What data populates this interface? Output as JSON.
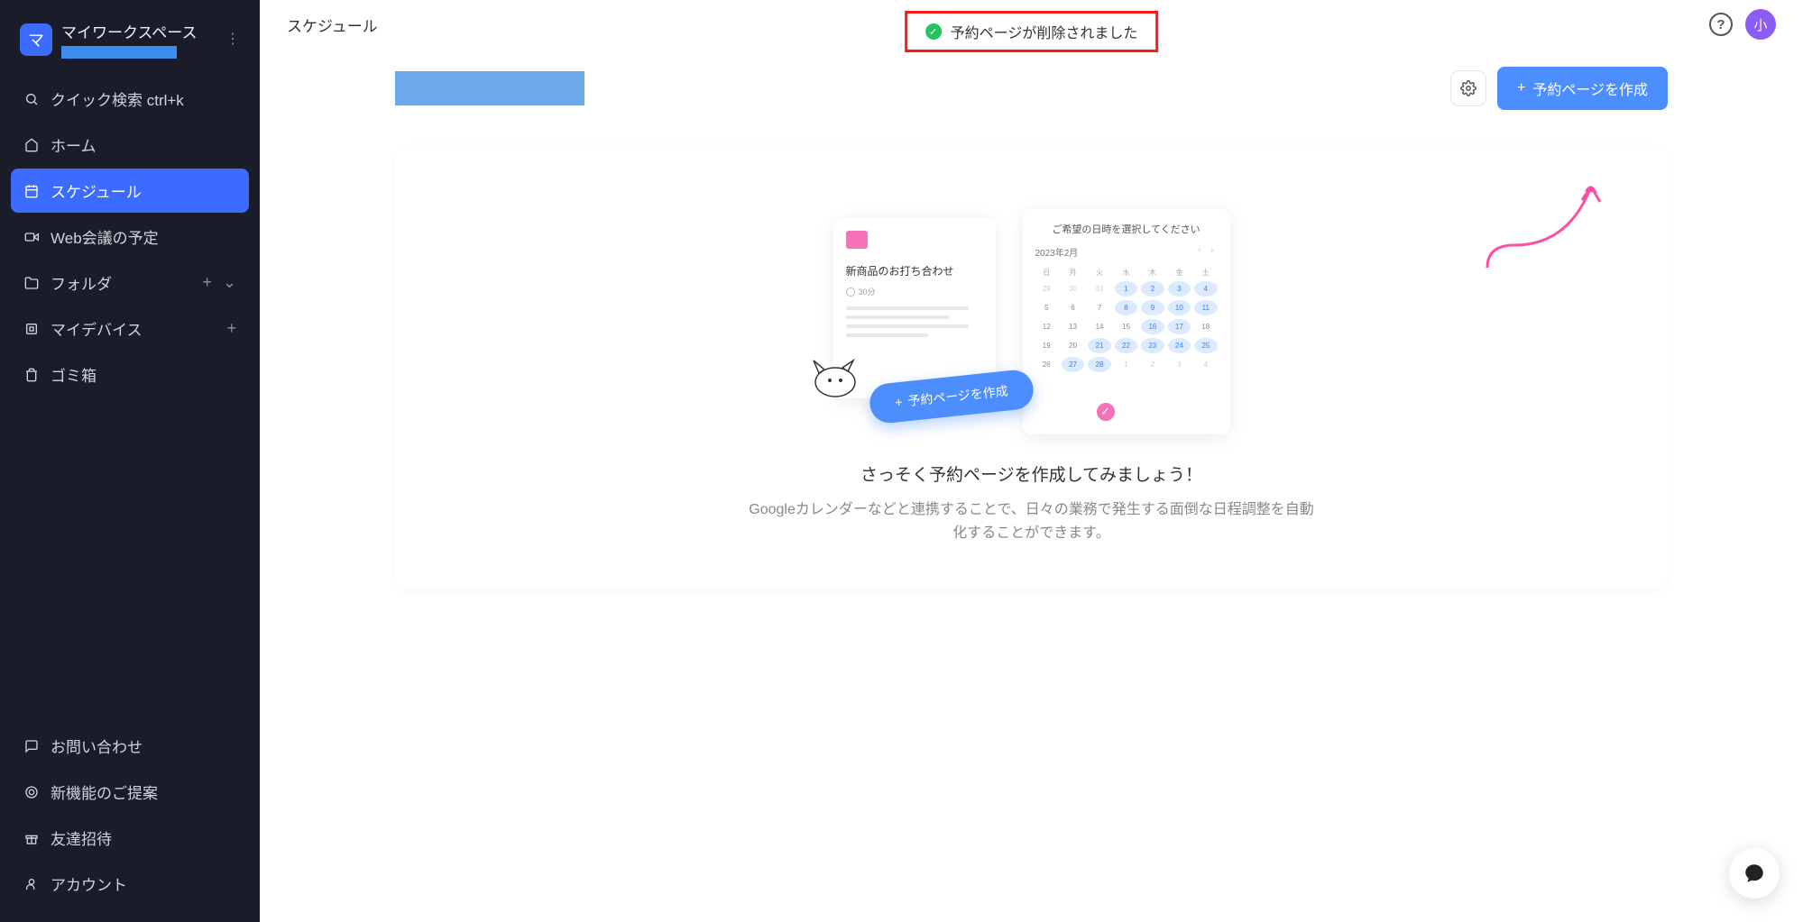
{
  "workspace": {
    "badge": "マ",
    "title": "マイワークスペース"
  },
  "sidebar": {
    "search": "クイック検索 ctrl+k",
    "home": "ホーム",
    "schedule": "スケジュール",
    "web_meeting": "Web会議の予定",
    "folder": "フォルダ",
    "my_device": "マイデバイス",
    "trash": "ゴミ箱",
    "contact": "お問い合わせ",
    "feedback": "新機能のご提案",
    "invite": "友達招待",
    "account": "アカウント"
  },
  "topbar": {
    "title": "スケジュール",
    "avatar": "小"
  },
  "toast": {
    "message": "予約ページが削除されました"
  },
  "actions": {
    "create_button": "予約ページを作成"
  },
  "empty": {
    "title": "さっそく予約ページを作成してみましょう！",
    "desc": "Googleカレンダーなどと連携することで、日々の業務で発生する面倒な日程調整を自動化することができます。"
  },
  "illus": {
    "panel_title": "新商品のお打ち合わせ",
    "panel_sub": "30分",
    "cal_title": "ご希望の日時を選択してください",
    "cal_month": "2023年2月",
    "dow": [
      "日",
      "月",
      "火",
      "水",
      "木",
      "金",
      "土"
    ],
    "days": [
      {
        "n": "29",
        "c": "muted"
      },
      {
        "n": "30",
        "c": "muted"
      },
      {
        "n": "31",
        "c": "muted"
      },
      {
        "n": "1",
        "c": "avail"
      },
      {
        "n": "2",
        "c": "avail"
      },
      {
        "n": "3",
        "c": "avail"
      },
      {
        "n": "4",
        "c": "avail"
      },
      {
        "n": "5",
        "c": ""
      },
      {
        "n": "6",
        "c": ""
      },
      {
        "n": "7",
        "c": ""
      },
      {
        "n": "8",
        "c": "avail"
      },
      {
        "n": "9",
        "c": "avail"
      },
      {
        "n": "10",
        "c": "avail"
      },
      {
        "n": "11",
        "c": "avail"
      },
      {
        "n": "12",
        "c": ""
      },
      {
        "n": "13",
        "c": ""
      },
      {
        "n": "14",
        "c": ""
      },
      {
        "n": "15",
        "c": ""
      },
      {
        "n": "16",
        "c": "avail"
      },
      {
        "n": "17",
        "c": "avail"
      },
      {
        "n": "18",
        "c": ""
      },
      {
        "n": "19",
        "c": ""
      },
      {
        "n": "20",
        "c": ""
      },
      {
        "n": "21",
        "c": "avail"
      },
      {
        "n": "22",
        "c": "avail"
      },
      {
        "n": "23",
        "c": "avail"
      },
      {
        "n": "24",
        "c": "avail"
      },
      {
        "n": "25",
        "c": "avail"
      },
      {
        "n": "26",
        "c": ""
      },
      {
        "n": "27",
        "c": "avail"
      },
      {
        "n": "28",
        "c": "avail"
      },
      {
        "n": "1",
        "c": "muted"
      },
      {
        "n": "2",
        "c": "muted"
      },
      {
        "n": "3",
        "c": "muted"
      },
      {
        "n": "4",
        "c": "muted"
      }
    ],
    "button": "予約ページを作成"
  }
}
